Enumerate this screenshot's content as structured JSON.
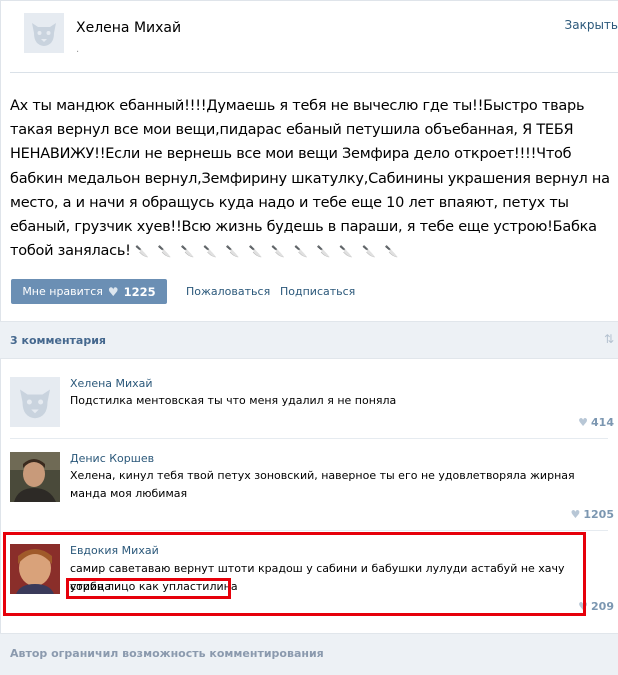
{
  "post": {
    "author": "Хелена Михай",
    "author_sub": ".",
    "close": "Закрыть",
    "text": "Ах ты мандюк ебанный!!!!Думаешь я тебя не вычеслю где ты!!Быстро тварь такая вернул все мои вещи,пидарас ебаный петушила объебанная, Я ТЕБЯ НЕНАВИЖУ!!Если не вернешь все мои вещи Земфира дело откроет!!!!Чтоб бабкин медальон вернул,Земфирину шкатулку,Сабинины украшения вернул на место, а и начи я обращусь куда надо и тебе еще 10 лет впаяют, петух ты ебаный, грузчик хуев!!Всю жизнь будешь в параши, я тебе еще устрою!Бабка тобой занялась!",
    "knife_glyph": "🔪",
    "knife_count": 12
  },
  "actions": {
    "like_label": "Мне нравится",
    "like_icon": "heart-icon",
    "like_count": "1225",
    "report": "Пожаловаться",
    "subscribe": "Подписаться"
  },
  "comments_header": {
    "label": "3 комментария",
    "sort_icon": "sort-arrows-icon"
  },
  "comments": [
    {
      "name": "Хелена Михай",
      "text": "Подстилка ментовская ты что меня удалил я не поняла",
      "likes": "414",
      "avatar": "default-dog-avatar"
    },
    {
      "name": "Денис Коршев",
      "text": "Хелена, кинул тебя твой петух зоновский, наверное ты его не удовлетворяла жирная манда моя любимая",
      "likes": "1205",
      "avatar": "man-photo"
    },
    {
      "name": "Евдокия Михай",
      "text_line1": "самир саветаваю вернут штоти крадош у сабини и бабушки лулуди астабуй не хачу сорица",
      "text_line2": "утибя лицо как упластилина",
      "likes": "209",
      "avatar": "woman-photo"
    }
  ],
  "footer": {
    "text": "Автор ограничил возможность комментирования"
  },
  "colors": {
    "link": "#2b587a",
    "button": "#6b8fb4",
    "bar": "#edf1f5",
    "highlight": "#e6000a"
  }
}
